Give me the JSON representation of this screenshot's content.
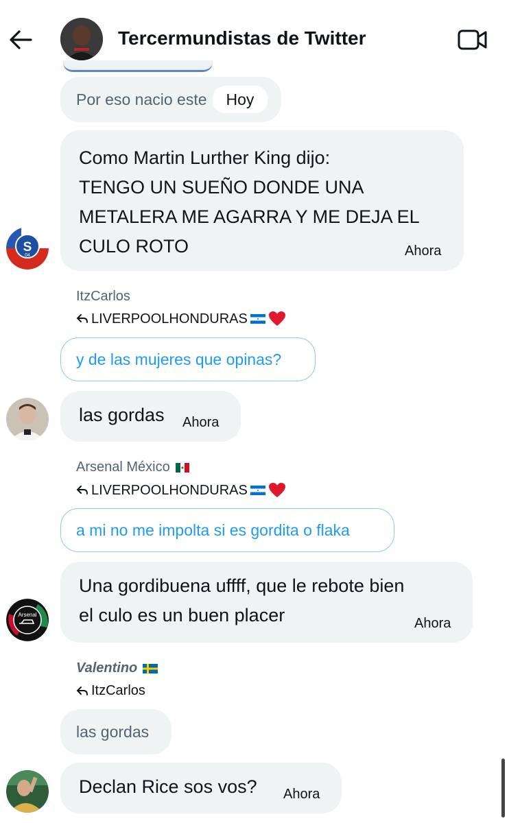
{
  "header": {
    "title": "Tercermundistas de Twitter",
    "back_icon": "arrow-left-icon",
    "video_icon": "video-camera-icon"
  },
  "messages": {
    "m0": {
      "text": "Por eso nacio este",
      "badge": "Hoy"
    },
    "m1": {
      "text": "Como Martin Lurther King dijo:\nTENGO UN SUEÑO DONDE UNA\nMETALERA ME AGARRA Y ME DEJA EL\nCULO ROTO",
      "time": "Ahora"
    },
    "m2": {
      "reply_to_name": "ItzCarlos",
      "replying_user": "LIVERPOOLHONDURAS",
      "quoted": "y de las mujeres que opinas?",
      "text": "las gordas",
      "time": "Ahora"
    },
    "m3": {
      "reply_to_name": "Arsenal México",
      "replying_user": "LIVERPOOLHONDURAS",
      "quoted": "a mi no me impolta si es gordita o flaka",
      "text": "Una gordibuena uffff, que le rebote bien\nel culo es un buen placer",
      "time": "Ahora"
    },
    "m4": {
      "reply_to_name": "Valentino",
      "replying_user": "ItzCarlos",
      "quoted": "las gordas",
      "text": "Declan Rice sos vos?",
      "time": "Ahora"
    }
  },
  "avatars": {
    "a1": "Schalke 04",
    "a3": "Arsenal"
  },
  "colors": {
    "bubble": "#eff3f4",
    "accent": "#1d9bf0",
    "muted": "#536471",
    "text": "#0f1419"
  }
}
